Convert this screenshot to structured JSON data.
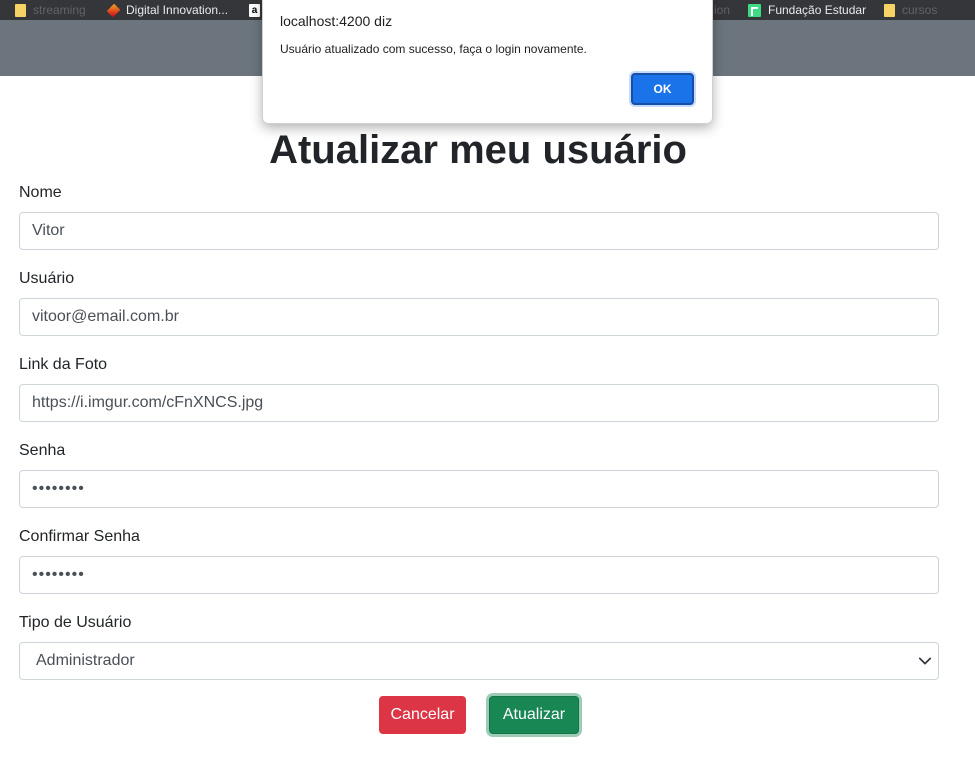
{
  "bookmarks": [
    {
      "label": "streaming",
      "icon": "folder-icon",
      "dim": true
    },
    {
      "label": "Digital Innovation...",
      "icon": "dio-icon",
      "dim": false
    },
    {
      "label": "a",
      "icon": "amazon-icon",
      "dim": false
    },
    {
      "label": "ion",
      "icon": "",
      "dim": true
    },
    {
      "label": "Fundação Estudar",
      "icon": "fundacao-estudar-icon",
      "dim": false
    },
    {
      "label": "cursos",
      "icon": "folder-icon",
      "dim": true
    }
  ],
  "dialog": {
    "title": "localhost:4200 diz",
    "message": "Usuário atualizado com sucesso, faça o login novamente.",
    "ok_label": "OK"
  },
  "page": {
    "title": "Atualizar meu usuário"
  },
  "form": {
    "nome": {
      "label": "Nome",
      "value": "Vitor"
    },
    "usuario": {
      "label": "Usuário",
      "value": "vitoor@email.com.br"
    },
    "foto": {
      "label": "Link da Foto",
      "value": "https://i.imgur.com/cFnXNCS.jpg"
    },
    "senha": {
      "label": "Senha",
      "value": "••••••••"
    },
    "confirmar": {
      "label": "Confirmar Senha",
      "value": "••••••••"
    },
    "tipo": {
      "label": "Tipo de Usuário",
      "value": "Administrador"
    }
  },
  "buttons": {
    "cancel": "Cancelar",
    "update": "Atualizar"
  },
  "colors": {
    "navbar": "#6c757d",
    "danger": "#dc3545",
    "success": "#198754",
    "dialog_ok": "#1a73e8"
  }
}
